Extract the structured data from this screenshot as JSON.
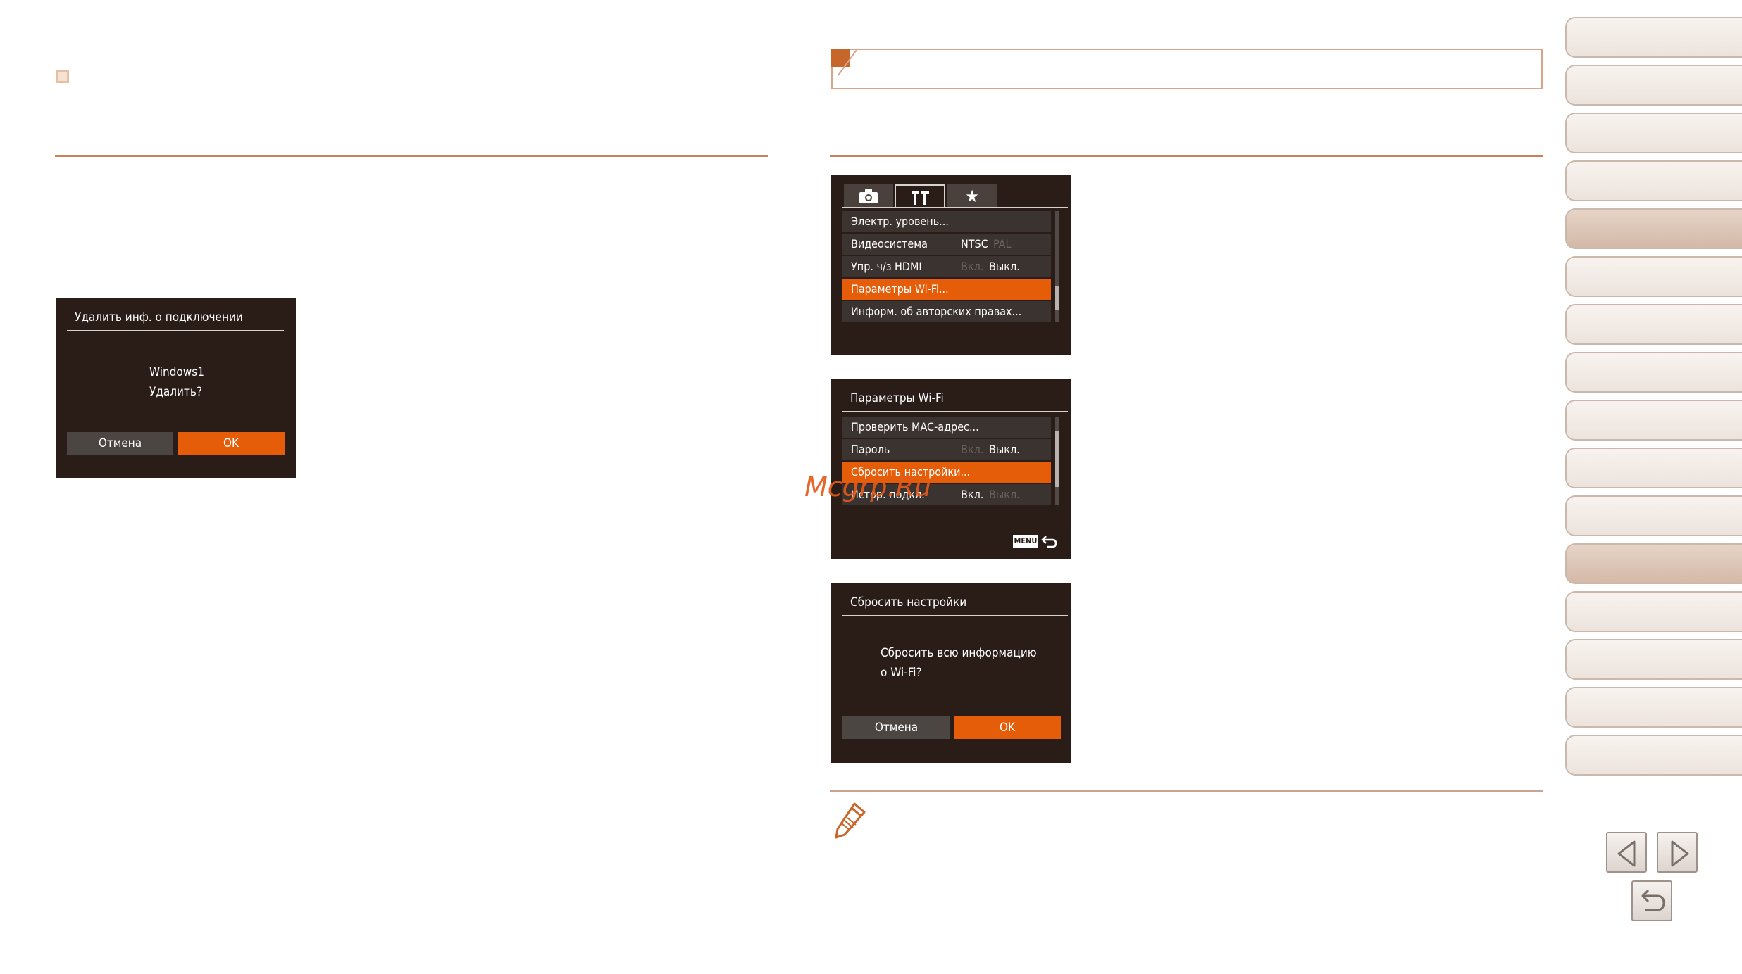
{
  "screen_delete": {
    "title": "Удалить инф. о подключении",
    "line1": "Windows1",
    "line2": "Удалить?",
    "cancel": "Отмена",
    "ok": "OK"
  },
  "screen_menu": {
    "rows": [
      {
        "label": "Электр. уровень..."
      },
      {
        "label": "Видеосистема",
        "opt1": "NTSC",
        "opt2": "PAL"
      },
      {
        "label": "Упр. ч/з HDMI",
        "opt1": "Вкл.",
        "opt2": "Выкл."
      },
      {
        "label": "Параметры Wi-Fi..."
      },
      {
        "label": "Информ. об авторских правах..."
      }
    ]
  },
  "screen_wifi": {
    "title": "Параметры Wi-Fi",
    "rows": [
      {
        "label": "Проверить MAC-адрес..."
      },
      {
        "label": "Пароль",
        "opt1": "Вкл.",
        "opt2": "Выкл."
      },
      {
        "label": "Сбросить настройки..."
      },
      {
        "label": "Истор. подкл.",
        "opt1": "Вкл.",
        "opt2": "Выкл."
      }
    ],
    "menu_key": "MENU"
  },
  "screen_reset": {
    "title": "Сбросить настройки",
    "line1": "Сбросить всю информацию",
    "line2": "о Wi-Fi?",
    "cancel": "Отмена",
    "ok": "OK"
  },
  "watermark": "Mcgrp.Ru",
  "colors": {
    "accent": "#e55d09",
    "rule": "#c8825a",
    "screen_bg": "#2a1d17"
  }
}
